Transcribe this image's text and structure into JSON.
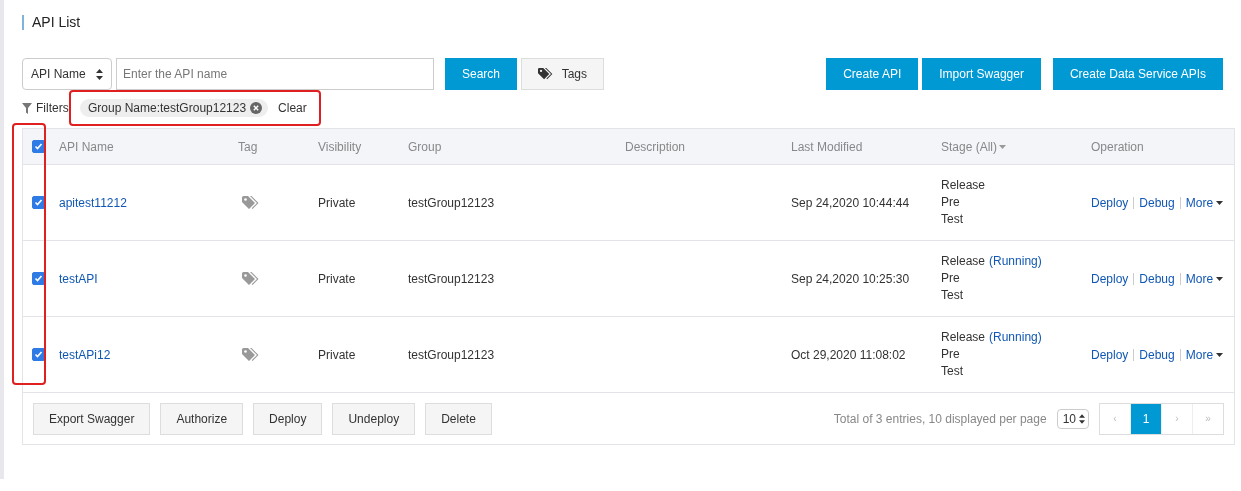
{
  "page_title": "API List",
  "search": {
    "field_select": "API Name",
    "placeholder": "Enter the API name",
    "search_button": "Search",
    "tags_button": "Tags"
  },
  "actions": [
    "Create API",
    "Import Swagger",
    "Create Data Service APIs"
  ],
  "filters": {
    "label": "Filters:",
    "chips": [
      "Group Name:testGroup12123"
    ],
    "clear": "Clear"
  },
  "table": {
    "select_all": {
      "checked": true
    },
    "columns": [
      "API Name",
      "Tag",
      "Visibility",
      "Group",
      "Description",
      "Last Modified",
      "Stage (All)",
      "Operation"
    ],
    "rows": [
      {
        "checked": true,
        "name": "apitest11212",
        "visibility": "Private",
        "group": "testGroup12123",
        "last_modified": "Sep 24,2020 10:44:44",
        "stages": [
          {
            "name": "Release"
          },
          {
            "name": "Pre"
          },
          {
            "name": "Test"
          }
        ],
        "operations": [
          "Deploy",
          "Debug",
          "More"
        ]
      },
      {
        "checked": true,
        "name": "testAPI",
        "visibility": "Private",
        "group": "testGroup12123",
        "last_modified": "Sep 24,2020 10:25:30",
        "stages": [
          {
            "name": "Release",
            "status": "(Running)"
          },
          {
            "name": "Pre"
          },
          {
            "name": "Test"
          }
        ],
        "operations": [
          "Deploy",
          "Debug",
          "More"
        ]
      },
      {
        "checked": true,
        "name": "testAPi12",
        "visibility": "Private",
        "group": "testGroup12123",
        "last_modified": "Oct 29,2020 11:08:02",
        "stages": [
          {
            "name": "Release",
            "status": "(Running)"
          },
          {
            "name": "Pre"
          },
          {
            "name": "Test"
          }
        ],
        "operations": [
          "Deploy",
          "Debug",
          "More"
        ]
      }
    ]
  },
  "bulk_actions": [
    "Export Swagger",
    "Authorize",
    "Deploy",
    "Undeploy",
    "Delete"
  ],
  "pagination": {
    "summary": "Total of 3 entries, 10 displayed per page",
    "page_size": "10",
    "prev": "‹",
    "pages": [
      {
        "label": "1",
        "selected": true
      }
    ],
    "next": "›",
    "last": "»"
  }
}
